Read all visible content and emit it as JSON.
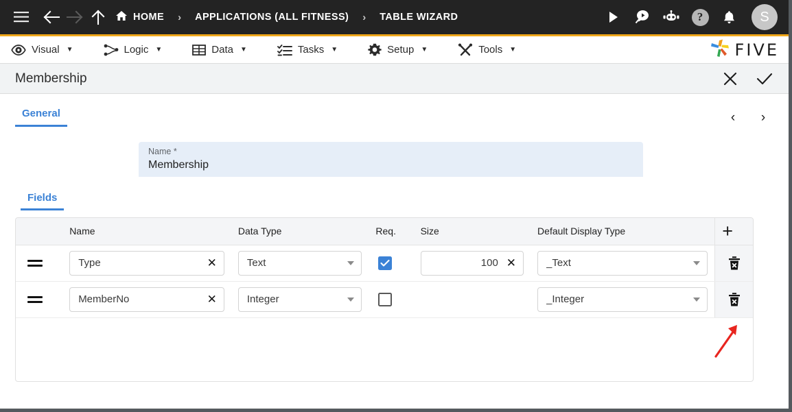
{
  "topbar": {
    "menu_icon": "hamburger-icon",
    "back_icon": "arrow-left-icon",
    "forward_icon": "arrow-right-icon",
    "up_icon": "arrow-up-icon",
    "home_icon": "home-icon",
    "breadcrumbs": [
      {
        "label": "HOME",
        "icon": "home-icon"
      },
      {
        "label": "APPLICATIONS (ALL FITNESS)",
        "icon": ""
      },
      {
        "label": "TABLE WIZARD",
        "icon": ""
      }
    ],
    "separator": "›",
    "actions": [
      {
        "name": "run-icon",
        "glyph": "▶"
      },
      {
        "name": "search-icon",
        "glyph": ""
      },
      {
        "name": "chatbot-icon",
        "glyph": ""
      },
      {
        "name": "help-icon",
        "glyph": "?"
      },
      {
        "name": "notifications-bell-icon",
        "glyph": ""
      }
    ],
    "avatar_initial": "S",
    "background": "#232323"
  },
  "menubar": {
    "accent": "#f0a71a",
    "items": [
      {
        "label": "Visual",
        "icon": "eye-icon",
        "caret": "▼"
      },
      {
        "label": "Logic",
        "icon": "logic-nodes-icon",
        "caret": "▼"
      },
      {
        "label": "Data",
        "icon": "table-icon",
        "caret": "▼"
      },
      {
        "label": "Tasks",
        "icon": "checklist-icon",
        "caret": "▼"
      },
      {
        "label": "Setup",
        "icon": "gear-icon",
        "caret": "▼"
      },
      {
        "label": "Tools",
        "icon": "tools-icon",
        "caret": "▼"
      }
    ],
    "brand": "FIVE",
    "brand_icon": "five-pinwheel-logo"
  },
  "titlebar": {
    "title": "Membership",
    "close_icon": "close-icon",
    "confirm_icon": "check-icon"
  },
  "content": {
    "tab": {
      "label": "General",
      "color": "#3b82d6"
    },
    "pager": {
      "prev": "‹",
      "next": "›"
    },
    "name_field": {
      "label": "Name *",
      "value": "Membership",
      "background": "#e6eef8"
    },
    "fields_label": "Fields",
    "table": {
      "columns": [
        "Name",
        "Data Type",
        "Req.",
        "Size",
        "Default Display Type"
      ],
      "add_label": "+",
      "rows": [
        {
          "handle": "drag-handle",
          "name": "Type",
          "name_clear": "✕",
          "data_type": "Text",
          "required": true,
          "size": "100",
          "size_clear": "✕",
          "default_display_type": "_Text",
          "delete_icon": "delete-row-icon"
        },
        {
          "handle": "drag-handle",
          "name": "MemberNo",
          "name_clear": "✕",
          "data_type": "Integer",
          "required": false,
          "size": "",
          "size_clear": "",
          "default_display_type": "_Integer",
          "delete_icon": "delete-row-icon"
        }
      ]
    },
    "annotation": {
      "name": "red-arrow-annotation",
      "color": "#e8251f"
    }
  }
}
